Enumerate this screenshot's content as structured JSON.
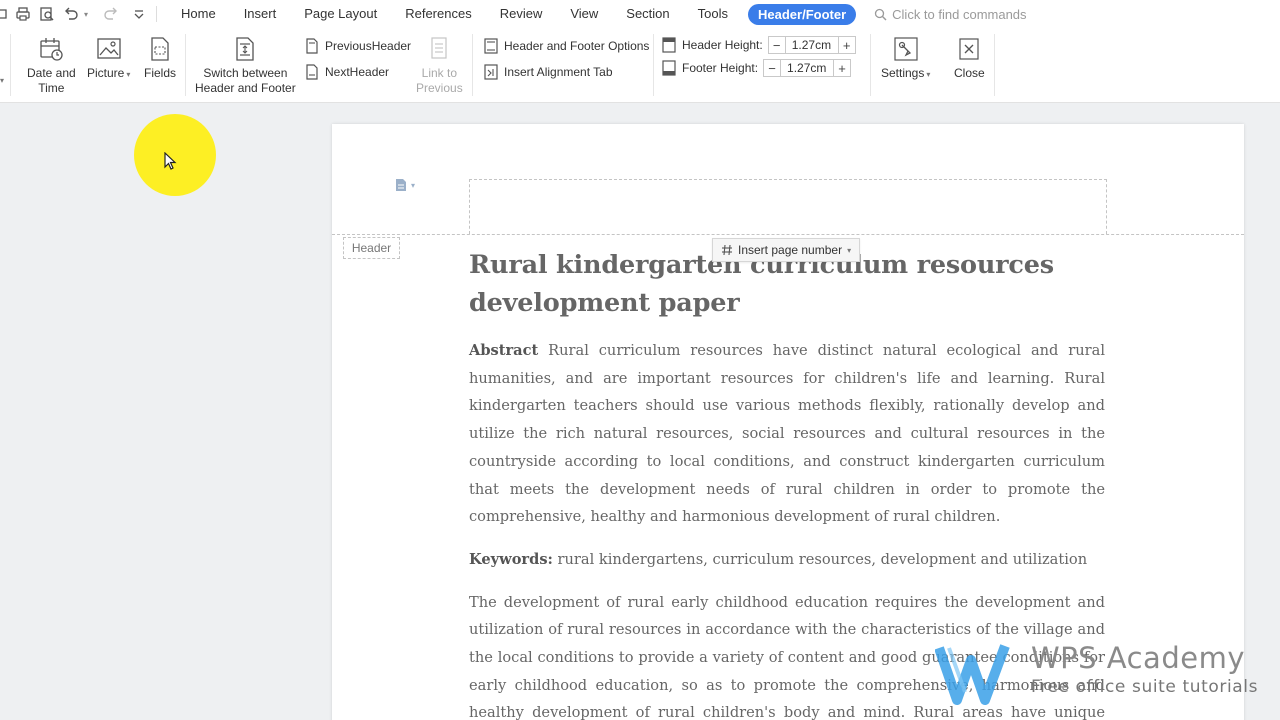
{
  "menu": {
    "tabs": [
      "Home",
      "Insert",
      "Page Layout",
      "References",
      "Review",
      "View",
      "Section",
      "Tools"
    ],
    "active_tab": "Header/Footer",
    "find_placeholder": "Click to find commands"
  },
  "ribbon": {
    "date_time": "Date and\nTime",
    "picture": "Picture",
    "fields": "Fields",
    "switch": "Switch between\nHeader and Footer",
    "previous_header": "PreviousHeader",
    "next_header": "NextHeader",
    "link_to_previous": "Link to\nPrevious",
    "hf_options": "Header and Footer Options",
    "insert_alignment_tab": "Insert Alignment Tab",
    "header_height_label": "Header Height:",
    "header_height_value": "1.27cm",
    "footer_height_label": "Footer Height:",
    "footer_height_value": "1.27cm",
    "settings": "Settings",
    "close": "Close"
  },
  "page": {
    "header_tag": "Header",
    "insert_page_number": "Insert page number",
    "title": "Rural kindergarten curriculum resources development paper",
    "abstract_label": "Abstract",
    "abstract_text": " Rural curriculum resources have distinct natural ecological and rural humanities, and are important resources for children's life and learning. Rural kindergarten teachers should use various methods flexibly, rationally develop and utilize the rich natural resources, social resources and cultural resources in the countryside according to local conditions, and construct kindergarten curriculum that meets the development needs of rural children in order to promote the comprehensive, healthy and harmonious development of rural children.",
    "keywords_label": "Keywords:",
    "keywords_text": " rural kindergartens, curriculum resources, development and utilization",
    "body_text": "The development of rural early childhood education requires the development and utilization of rural resources in accordance with the characteristics of the village and the local conditions to provide a variety of content and good guarantee conditions for early childhood education, so as to promote the comprehensive, harmonious and healthy development of rural children's body and mind. Rural areas have unique regional"
  },
  "watermark": {
    "title": "WPS Academy",
    "subtitle": "Free office suite tutorials"
  },
  "colors": {
    "accent": "#3a7de9",
    "cursor_highlight": "#ffee00"
  }
}
